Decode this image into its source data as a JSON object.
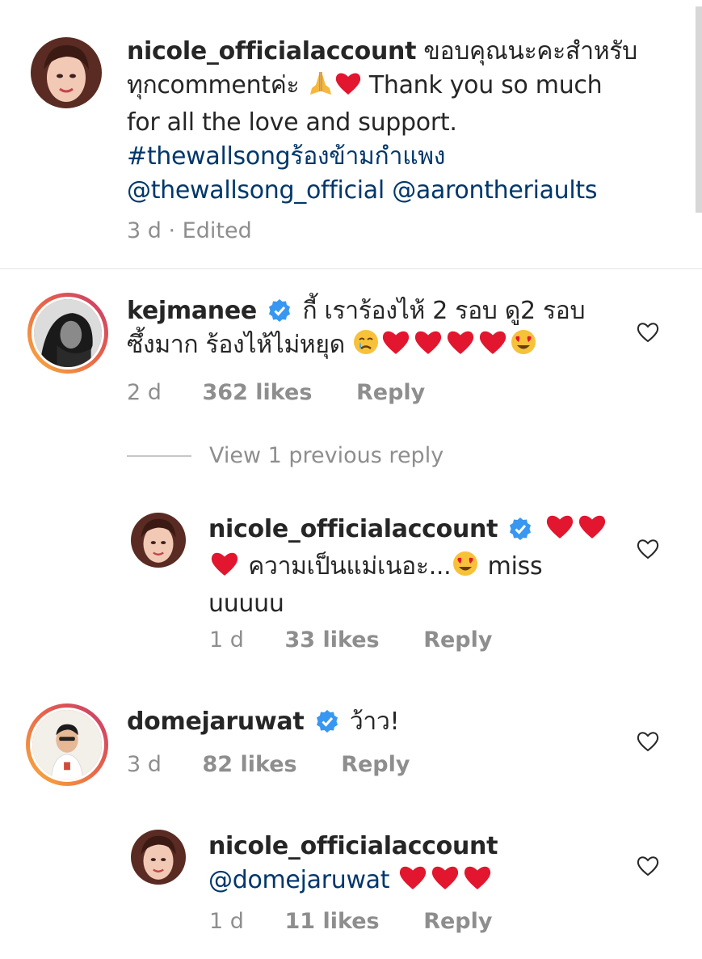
{
  "main_comment": {
    "username": "nicole_officialaccount",
    "text_line1": "ขอบคุณนะคะสำหรับ",
    "text_line2_prefix": "ทุกcommentค่ะ",
    "text_line2_suffix": "Thank you so much",
    "text_line3": "for all the love and support.",
    "hashtag": "#thewallsongร้องข้ามกำแพง",
    "mention1": "@thewallsong_official",
    "mention2": "@aarontheriaults",
    "age": "3 d",
    "edited": "· Edited"
  },
  "comments": [
    {
      "username": "kejmanee",
      "text_line1": "กี้ เราร้องไห้ 2 รอบ ดู2 รอบ",
      "text_line2": "ซึ้งมาก ร้องไห้ไม่หยุด",
      "age": "2 d",
      "likes": "362 likes",
      "reply": "Reply"
    },
    {
      "username": "nicole_officialaccount",
      "text_line2": "ความเป็นแม่เนอะ...",
      "text_line2_suffix": "miss",
      "text_line3": "uuuuu",
      "age": "1 d",
      "likes": "33 likes",
      "reply": "Reply"
    },
    {
      "username": "domejaruwat",
      "text": "ว้าว!",
      "age": "3 d",
      "likes": "82 likes",
      "reply": "Reply"
    },
    {
      "username": "nicole_officialaccount",
      "mention": "@domejaruwat",
      "age": "1 d",
      "likes": "11 likes",
      "reply": "Reply"
    }
  ],
  "view_replies": "View 1 previous reply",
  "colors": {
    "text": "#262626",
    "muted": "#8e8e8e",
    "link": "#00376b",
    "verified": "#3897f0",
    "heart": "#ed1c3a"
  },
  "icons": [
    "heart-outline-icon",
    "verified-badge-icon",
    "folded-hands-emoji",
    "red-heart-emoji",
    "crying-face-emoji",
    "heart-eyes-emoji"
  ]
}
